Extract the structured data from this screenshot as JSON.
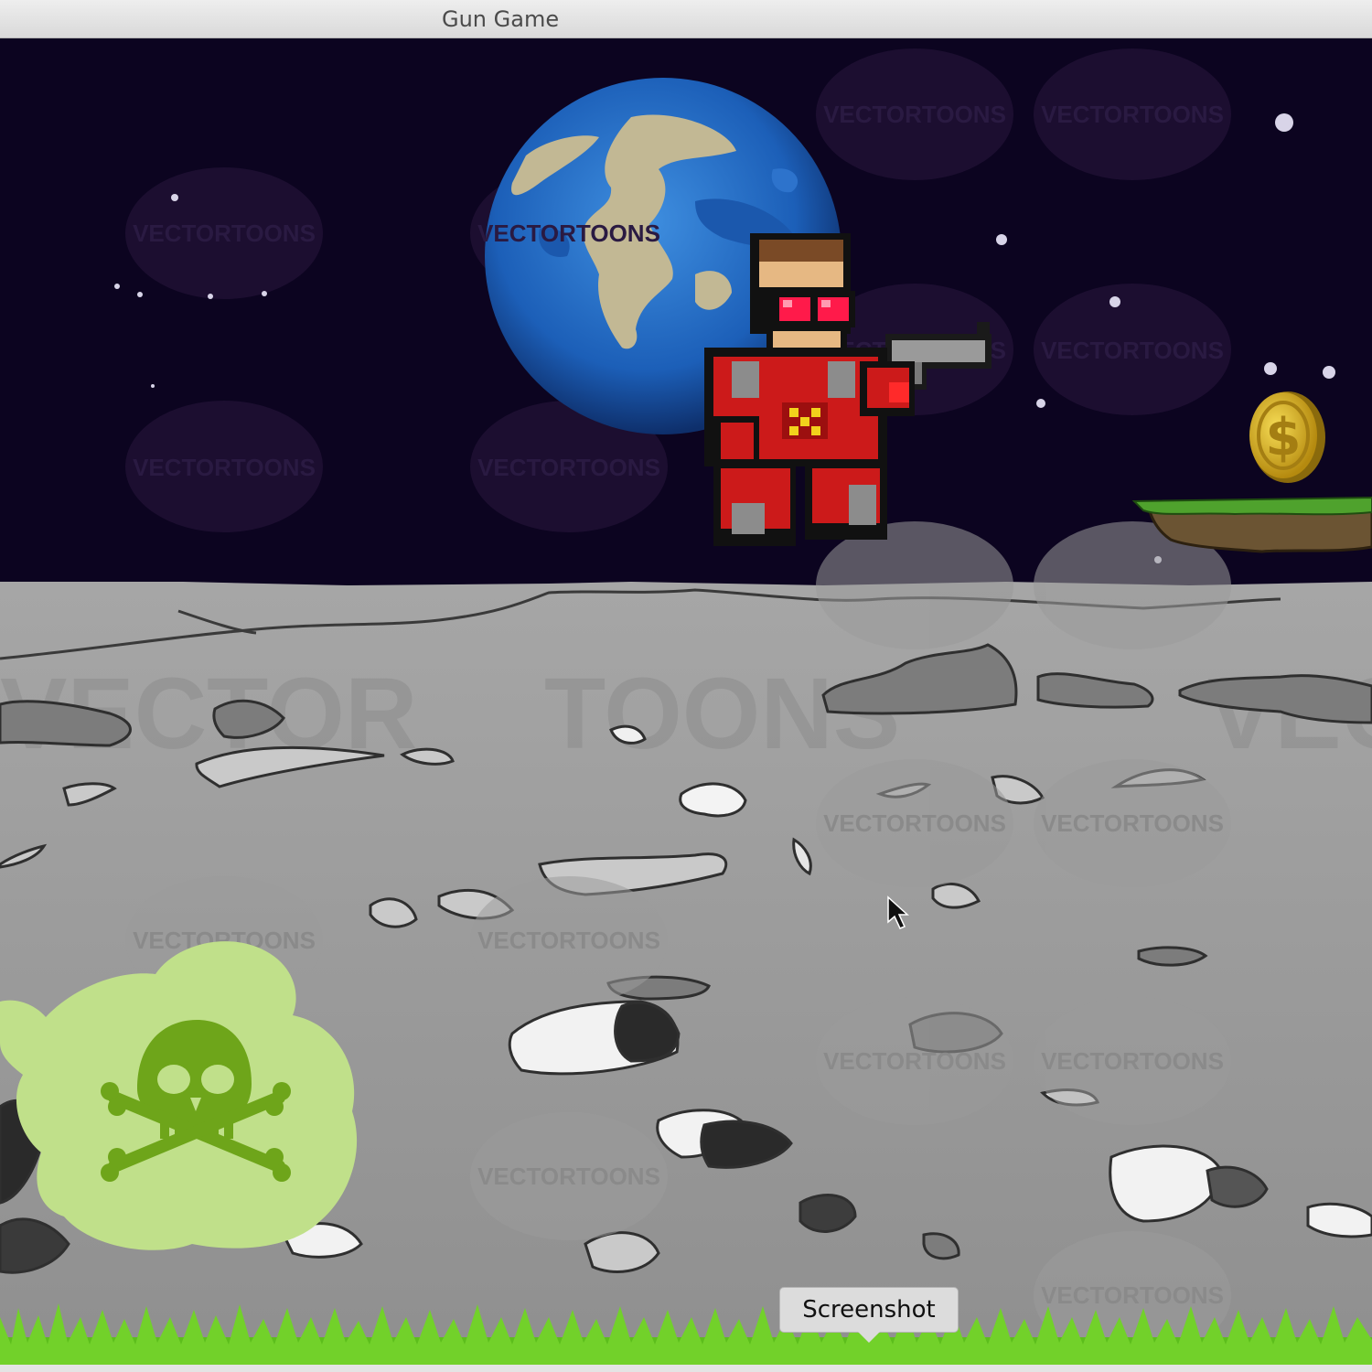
{
  "window": {
    "title": "Gun Game"
  },
  "scene": {
    "description_icons": [
      "planet-earth",
      "pixel-hero-with-pistol",
      "gold-coin",
      "floating-grass-platform",
      "toxic-skull-cloud"
    ],
    "colors": {
      "sky": "#0c0420",
      "moon_surface": "#9e9e9e",
      "grass": "#66cc22",
      "coin": "#e2b81f",
      "toxic_cloud": "#c0e08a",
      "skull": "#6ea51a",
      "hero_suit": "#cc1a1a"
    },
    "watermarks": [
      "VECTORTOONS",
      "VECTORTOONS",
      "VECTORTOONS",
      "VECTORTOONS",
      "VECTORTOONS",
      "VECTORTOONS",
      "VECTORTOONS",
      "VECTORTOONS",
      "VECTORTOONS",
      "VECTORTOONS",
      "VECTORTOONS",
      "VECTORTOONS",
      "VECTORTOONS",
      "VECTORTOONS",
      "VECTORTOONS",
      "VECTORTOONS"
    ],
    "big_watermark": [
      "VECTOR",
      "TOONS",
      "VEC"
    ],
    "coin_symbol": "$"
  },
  "tooltip": {
    "label": "Screenshot"
  }
}
